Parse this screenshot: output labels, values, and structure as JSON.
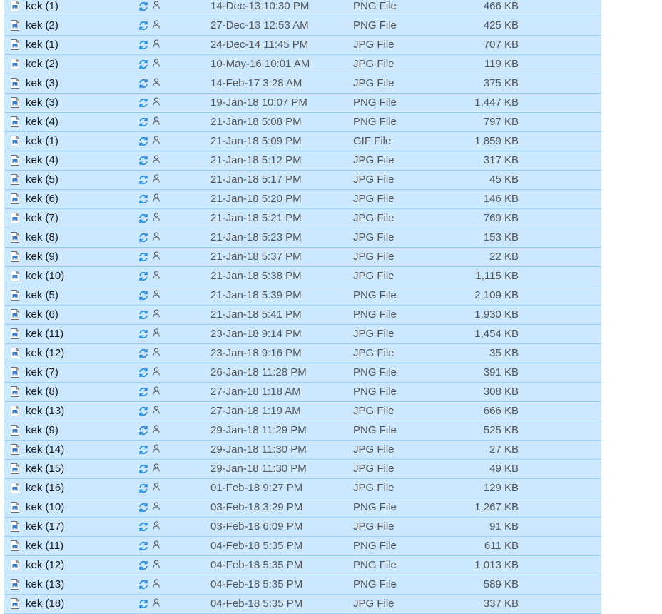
{
  "icons": {
    "file": "image-file-icon",
    "status": "sync-status-icon",
    "shared": "shared-person-icon"
  },
  "colors": {
    "selection_bg": "#cce8ff",
    "selection_border": "#99d1ff",
    "sync_icon": "#1e88e5"
  },
  "files": [
    {
      "name": "kek (1)",
      "date": "14-Dec-13 10:30 PM",
      "type": "PNG File",
      "size": "466 KB"
    },
    {
      "name": "kek (2)",
      "date": "27-Dec-13 12:53 AM",
      "type": "PNG File",
      "size": "425 KB"
    },
    {
      "name": "kek (1)",
      "date": "24-Dec-14 11:45 PM",
      "type": "JPG File",
      "size": "707 KB"
    },
    {
      "name": "kek (2)",
      "date": "10-May-16 10:01 AM",
      "type": "JPG File",
      "size": "119 KB"
    },
    {
      "name": "kek (3)",
      "date": "14-Feb-17 3:28 AM",
      "type": "JPG File",
      "size": "375 KB"
    },
    {
      "name": "kek (3)",
      "date": "19-Jan-18 10:07 PM",
      "type": "PNG File",
      "size": "1,447 KB"
    },
    {
      "name": "kek (4)",
      "date": "21-Jan-18 5:08 PM",
      "type": "PNG File",
      "size": "797 KB"
    },
    {
      "name": "kek (1)",
      "date": "21-Jan-18 5:09 PM",
      "type": "GIF File",
      "size": "1,859 KB"
    },
    {
      "name": "kek (4)",
      "date": "21-Jan-18 5:12 PM",
      "type": "JPG File",
      "size": "317 KB"
    },
    {
      "name": "kek (5)",
      "date": "21-Jan-18 5:17 PM",
      "type": "JPG File",
      "size": "45 KB"
    },
    {
      "name": "kek (6)",
      "date": "21-Jan-18 5:20 PM",
      "type": "JPG File",
      "size": "146 KB"
    },
    {
      "name": "kek (7)",
      "date": "21-Jan-18 5:21 PM",
      "type": "JPG File",
      "size": "769 KB"
    },
    {
      "name": "kek (8)",
      "date": "21-Jan-18 5:23 PM",
      "type": "JPG File",
      "size": "153 KB"
    },
    {
      "name": "kek (9)",
      "date": "21-Jan-18 5:37 PM",
      "type": "JPG File",
      "size": "22 KB"
    },
    {
      "name": "kek (10)",
      "date": "21-Jan-18 5:38 PM",
      "type": "JPG File",
      "size": "1,115 KB"
    },
    {
      "name": "kek (5)",
      "date": "21-Jan-18 5:39 PM",
      "type": "PNG File",
      "size": "2,109 KB"
    },
    {
      "name": "kek (6)",
      "date": "21-Jan-18 5:41 PM",
      "type": "PNG File",
      "size": "1,930 KB"
    },
    {
      "name": "kek (11)",
      "date": "23-Jan-18 9:14 PM",
      "type": "JPG File",
      "size": "1,454 KB"
    },
    {
      "name": "kek (12)",
      "date": "23-Jan-18 9:16 PM",
      "type": "JPG File",
      "size": "35 KB"
    },
    {
      "name": "kek (7)",
      "date": "26-Jan-18 11:28 PM",
      "type": "PNG File",
      "size": "391 KB"
    },
    {
      "name": "kek (8)",
      "date": "27-Jan-18 1:18 AM",
      "type": "PNG File",
      "size": "308 KB"
    },
    {
      "name": "kek (13)",
      "date": "27-Jan-18 1:19 AM",
      "type": "JPG File",
      "size": "666 KB"
    },
    {
      "name": "kek (9)",
      "date": "29-Jan-18 11:29 PM",
      "type": "PNG File",
      "size": "525 KB"
    },
    {
      "name": "kek (14)",
      "date": "29-Jan-18 11:30 PM",
      "type": "JPG File",
      "size": "27 KB"
    },
    {
      "name": "kek (15)",
      "date": "29-Jan-18 11:30 PM",
      "type": "JPG File",
      "size": "49 KB"
    },
    {
      "name": "kek (16)",
      "date": "01-Feb-18 9:27 PM",
      "type": "JPG File",
      "size": "129 KB"
    },
    {
      "name": "kek (10)",
      "date": "03-Feb-18 3:29 PM",
      "type": "PNG File",
      "size": "1,267 KB"
    },
    {
      "name": "kek (17)",
      "date": "03-Feb-18 6:09 PM",
      "type": "JPG File",
      "size": "91 KB"
    },
    {
      "name": "kek (11)",
      "date": "04-Feb-18 5:35 PM",
      "type": "PNG File",
      "size": "611 KB"
    },
    {
      "name": "kek (12)",
      "date": "04-Feb-18 5:35 PM",
      "type": "PNG File",
      "size": "1,013 KB"
    },
    {
      "name": "kek (13)",
      "date": "04-Feb-18 5:35 PM",
      "type": "PNG File",
      "size": "589 KB"
    },
    {
      "name": "kek (18)",
      "date": "04-Feb-18 5:35 PM",
      "type": "JPG File",
      "size": "337 KB"
    }
  ]
}
